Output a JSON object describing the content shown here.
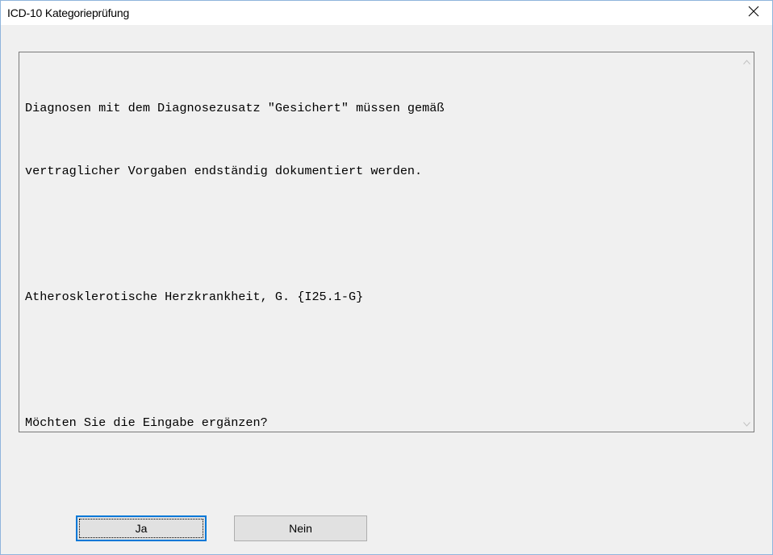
{
  "window": {
    "title": "ICD-10 Kategorieprüfung"
  },
  "message": {
    "lines": [
      "Diagnosen mit dem Diagnosezusatz \"Gesichert\" müssen gemäß",
      "vertraglicher Vorgaben endständig dokumentiert werden.",
      "",
      "Atherosklerotische Herzkrankheit, G. {I25.1-G}",
      "",
      "Möchten Sie die Eingabe ergänzen?"
    ]
  },
  "buttons": {
    "yes_label": "Ja",
    "no_label": "Nein"
  },
  "icons": {
    "close": "close-icon",
    "scroll_up": "chevron-up-icon",
    "scroll_down": "chevron-down-icon"
  },
  "colors": {
    "window_border": "#8fb4dc",
    "dialog_background": "#f0f0f0",
    "focus_accent": "#0078d7"
  }
}
